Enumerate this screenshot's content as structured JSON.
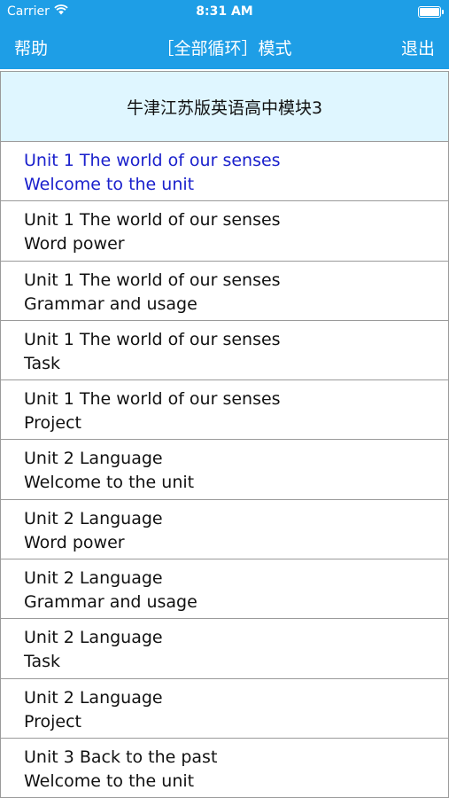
{
  "status_bar": {
    "carrier": "Carrier",
    "time": "8:31 AM",
    "wifi_icon": "wifi-icon",
    "battery_icon": "battery-icon",
    "battery_level": 1.0
  },
  "nav": {
    "left_label": "帮助",
    "title": "［全部循环］模式",
    "right_label": "退出"
  },
  "book": {
    "title": "牛津江苏版英语高中模块3"
  },
  "colors": {
    "accent": "#1e9ee6",
    "header_bg": "#dff6ff",
    "active_text": "#1a20cc",
    "text": "#111111"
  },
  "lessons": [
    {
      "line1": "Unit 1 The world of our senses",
      "line2": "Welcome to the unit",
      "active": true
    },
    {
      "line1": "Unit 1 The world of our senses",
      "line2": "Word power",
      "active": false
    },
    {
      "line1": "Unit 1 The world of our senses",
      "line2": "Grammar and usage",
      "active": false
    },
    {
      "line1": "Unit 1 The world of our senses",
      "line2": "Task",
      "active": false
    },
    {
      "line1": "Unit 1 The world of our senses",
      "line2": "Project",
      "active": false
    },
    {
      "line1": "Unit 2 Language",
      "line2": "Welcome to the unit",
      "active": false
    },
    {
      "line1": "Unit 2 Language",
      "line2": "Word power",
      "active": false
    },
    {
      "line1": "Unit 2 Language",
      "line2": "Grammar and usage",
      "active": false
    },
    {
      "line1": "Unit 2 Language",
      "line2": "Task",
      "active": false
    },
    {
      "line1": "Unit 2 Language",
      "line2": "Project",
      "active": false
    },
    {
      "line1": "Unit 3 Back to the past",
      "line2": "Welcome to the unit",
      "active": false
    }
  ]
}
